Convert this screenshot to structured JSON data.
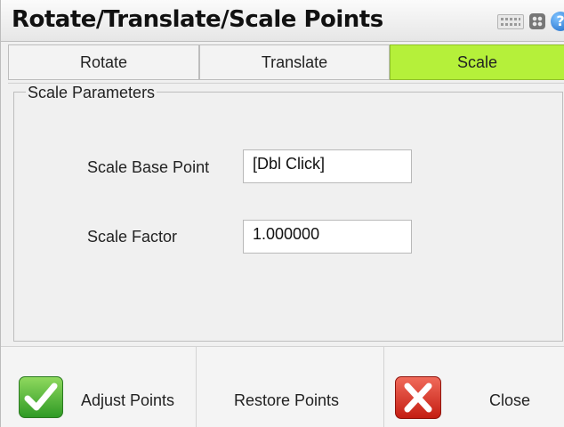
{
  "window": {
    "title": "Rotate/Translate/Scale Points"
  },
  "title_icons": [
    "keyboard-icon",
    "grid-icon",
    "help-icon"
  ],
  "tabs": [
    {
      "label": "Rotate",
      "active": false
    },
    {
      "label": "Translate",
      "active": false
    },
    {
      "label": "Scale",
      "active": true
    }
  ],
  "colors": {
    "active_tab": "#b5f03a"
  },
  "scale_parameters": {
    "legend": "Scale Parameters",
    "base_point_label": "Scale Base Point",
    "base_point_value": "[Dbl Click]",
    "factor_label": "Scale Factor",
    "factor_value": "1.000000"
  },
  "buttons": {
    "adjust": "Adjust Points",
    "restore": "Restore Points",
    "close": "Close"
  }
}
